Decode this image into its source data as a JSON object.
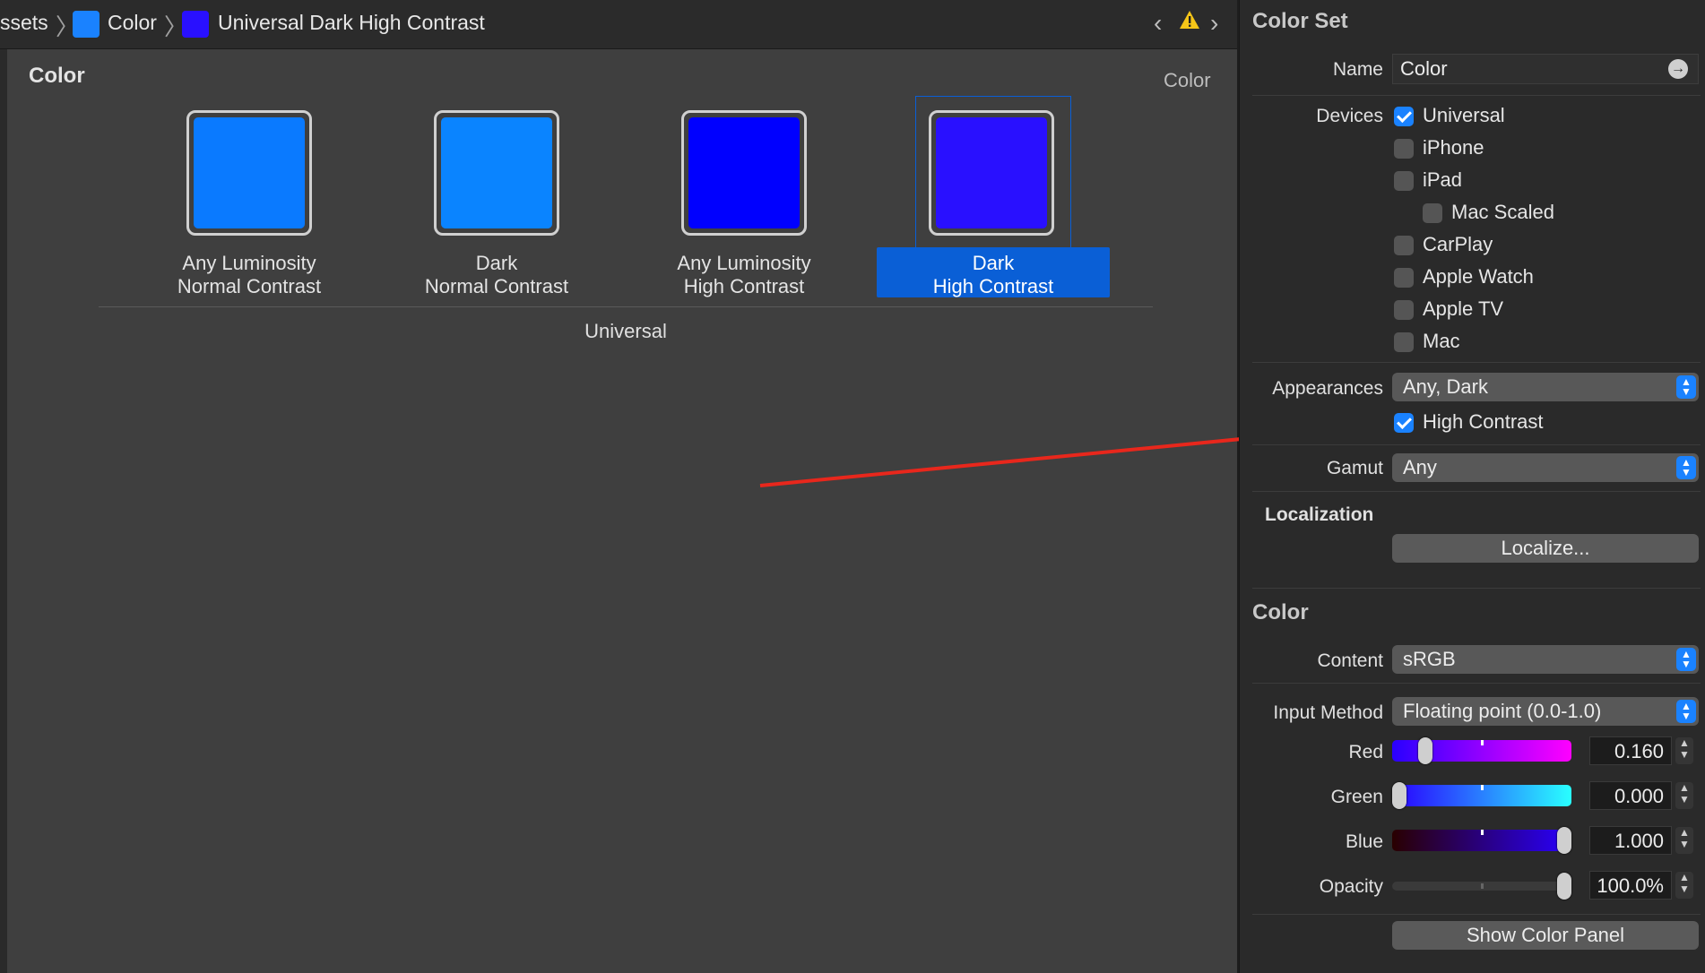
{
  "breadcrumb": {
    "items": [
      "ssets",
      "Color",
      "Universal Dark High Contrast"
    ],
    "swatch_colors": [
      "#1a82ff",
      "#2910ff"
    ]
  },
  "editor": {
    "title": "Color",
    "set_label": "Color",
    "group_label": "Universal",
    "wells": [
      {
        "line1": "Any Luminosity",
        "line2": "Normal Contrast",
        "color": "#0a7aff"
      },
      {
        "line1": "Dark",
        "line2": "Normal Contrast",
        "color": "#0a84ff"
      },
      {
        "line1": "Any Luminosity",
        "line2": "High Contrast",
        "color": "#0000ff"
      },
      {
        "line1": "Dark",
        "line2": "High Contrast",
        "color": "#2910ff",
        "selected": true
      }
    ]
  },
  "inspector": {
    "color_set": {
      "section_title": "Color Set",
      "name_label": "Name",
      "name_value": "Color",
      "devices_label": "Devices",
      "devices": [
        {
          "label": "Universal",
          "checked": true
        },
        {
          "label": "iPhone",
          "checked": false
        },
        {
          "label": "iPad",
          "checked": false
        },
        {
          "label": "Mac Scaled",
          "checked": false
        },
        {
          "label": "CarPlay",
          "checked": false
        },
        {
          "label": "Apple Watch",
          "checked": false
        },
        {
          "label": "Apple TV",
          "checked": false
        },
        {
          "label": "Mac",
          "checked": false
        }
      ],
      "appearances_label": "Appearances",
      "appearances_value": "Any, Dark",
      "high_contrast_label": "High Contrast",
      "high_contrast_checked": true,
      "gamut_label": "Gamut",
      "gamut_value": "Any",
      "localization_label": "Localization",
      "localize_button": "Localize..."
    },
    "color": {
      "section_title": "Color",
      "content_label": "Content",
      "content_value": "sRGB",
      "input_method_label": "Input Method",
      "input_method_value": "Floating point (0.0-1.0)",
      "channels": [
        {
          "label": "Red",
          "value": "0.160",
          "level": 0.16
        },
        {
          "label": "Green",
          "value": "0.000",
          "level": 0.0
        },
        {
          "label": "Blue",
          "value": "1.000",
          "level": 1.0
        },
        {
          "label": "Opacity",
          "value": "100.0%",
          "level": 1.0
        }
      ],
      "show_panel_button": "Show Color Panel"
    }
  },
  "colors": {
    "accent": "#1a82ff",
    "annotation_arrow": "#e8271c",
    "selection": "#0a5fd6"
  }
}
